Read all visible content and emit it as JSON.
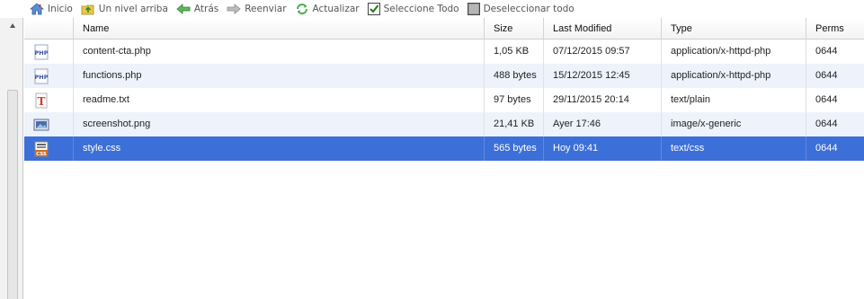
{
  "toolbar": {
    "home": "Inicio",
    "up": "Un nivel arriba",
    "back": "Atrás",
    "forward": "Reenviar",
    "refresh": "Actualizar",
    "select_all": "Seleccione Todo",
    "deselect_all": "Deseleccionar todo"
  },
  "columns": {
    "name": "Name",
    "size": "Size",
    "modified": "Last Modified",
    "type": "Type",
    "perms": "Perms"
  },
  "files": [
    {
      "icon": "php-file-icon",
      "name": "content-cta.php",
      "size": "1,05 KB",
      "modified": "07/12/2015 09:57",
      "type": "application/x-httpd-php",
      "perms": "0644"
    },
    {
      "icon": "php-file-icon",
      "name": "functions.php",
      "size": "488 bytes",
      "modified": "15/12/2015 12:45",
      "type": "application/x-httpd-php",
      "perms": "0644"
    },
    {
      "icon": "text-file-icon",
      "name": "readme.txt",
      "size": "97 bytes",
      "modified": "29/11/2015 20:14",
      "type": "text/plain",
      "perms": "0644"
    },
    {
      "icon": "image-file-icon",
      "name": "screenshot.png",
      "size": "21,41 KB",
      "modified": "Ayer 17:46",
      "type": "image/x-generic",
      "perms": "0644"
    },
    {
      "icon": "css-file-icon",
      "name": "style.css",
      "size": "565 bytes",
      "modified": "Hoy 09:41",
      "type": "text/css",
      "perms": "0644"
    }
  ],
  "selected_file": "style.css",
  "colors": {
    "selection": "#3d6fd8",
    "alt_row": "#edf2fb"
  }
}
